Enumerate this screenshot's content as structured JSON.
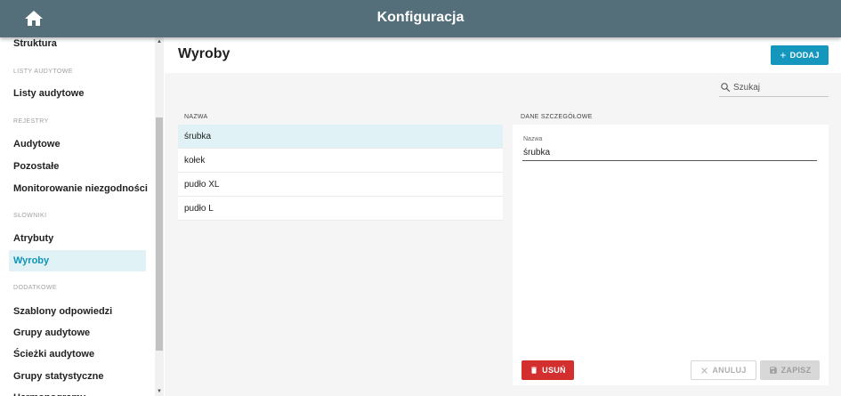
{
  "app": {
    "title": "Konfiguracja"
  },
  "sidebar": {
    "items": [
      {
        "label": "Struktura"
      },
      {
        "header": "LISTY AUDYTOWE"
      },
      {
        "label": "Listy audytowe"
      },
      {
        "header": "REJESTRY"
      },
      {
        "label": "Audytowe"
      },
      {
        "label": "Pozostałe"
      },
      {
        "label": "Monitorowanie niezgodności"
      },
      {
        "header": "SŁOWNIKI"
      },
      {
        "label": "Atrybuty"
      },
      {
        "label": "Wyroby",
        "active": true
      },
      {
        "header": "DODATKOWE"
      },
      {
        "label": "Szablony odpowiedzi"
      },
      {
        "label": "Grupy audytowe"
      },
      {
        "label": "Ścieżki audytowe"
      },
      {
        "label": "Grupy statystyczne"
      },
      {
        "label": "Harmonogramy"
      }
    ]
  },
  "main": {
    "title": "Wyroby",
    "add_label": "DODAJ",
    "search": {
      "placeholder": "Szukaj",
      "value": ""
    },
    "list": {
      "header": "NAZWA",
      "rows": [
        {
          "name": "śrubka",
          "selected": true
        },
        {
          "name": "kołek"
        },
        {
          "name": "pudło XL"
        },
        {
          "name": "pudło L"
        }
      ]
    },
    "detail": {
      "header": "DANE SZCZEGÓŁOWE",
      "name_label": "Nazwa",
      "name_value": "śrubka",
      "delete_label": "USUŃ",
      "cancel_label": "ANULUJ",
      "save_label": "ZAPISZ"
    }
  },
  "colors": {
    "topbar": "#546e7a",
    "accent": "#1496bd",
    "selected_bg": "#e0f2f6",
    "danger": "#d32f2f"
  },
  "icons": {
    "home": "home-icon",
    "search": "search-icon",
    "add": "plus-icon",
    "delete": "trash-icon",
    "cancel": "close-icon",
    "save": "floppy-icon"
  }
}
